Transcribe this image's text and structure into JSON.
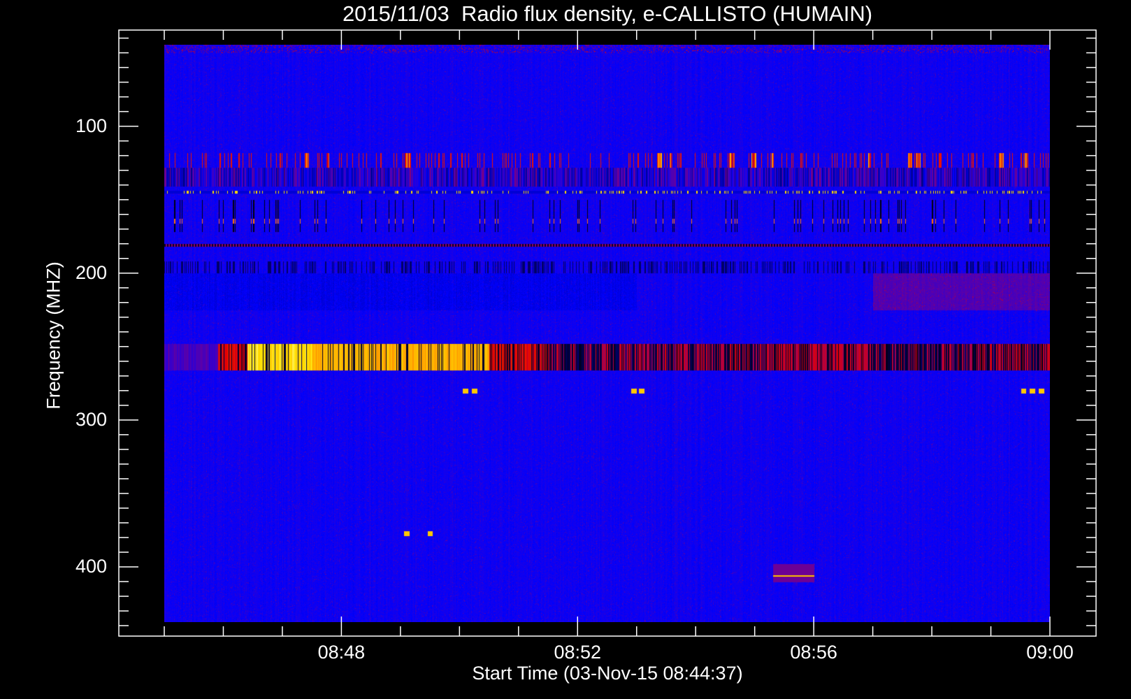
{
  "chart_data": {
    "type": "heatmap",
    "title": "2015/11/03  Radio flux density, e-CALLISTO (HUMAIN)",
    "xlabel": "Start Time (03-Nov-15 08:44:37)",
    "ylabel": "Frequency (MHZ)",
    "x_unit": "minutes after 08:45 UT",
    "xlim": [
      -0.76,
      15.78
    ],
    "data_xlim": [
      0,
      15
    ],
    "ylim": [
      447,
      34.6
    ],
    "data_ylim": [
      44.5,
      437.6
    ],
    "y_inverted": true,
    "x_major_ticks": [
      {
        "value": 3,
        "label": "08:48"
      },
      {
        "value": 7,
        "label": "08:52"
      },
      {
        "value": 11,
        "label": "08:56"
      },
      {
        "value": 15,
        "label": "09:00"
      }
    ],
    "x_minor_step": 1,
    "y_major_ticks": [
      {
        "value": 100,
        "label": "100"
      },
      {
        "value": 200,
        "label": "200"
      },
      {
        "value": 300,
        "label": "300"
      },
      {
        "value": 400,
        "label": "400"
      }
    ],
    "y_minor_step": 10,
    "colormap": [
      "#000000",
      "#0000ff",
      "#6400a0",
      "#e60000",
      "#ff8c00",
      "#ffe600",
      "#ffffff"
    ],
    "features": {
      "background_level": 0.3,
      "hot_band_mhz": [
        248,
        266
      ],
      "hot_band_segments": [
        {
          "t": [
            0.9,
            1.4
          ],
          "level": 0.62
        },
        {
          "t": [
            1.4,
            2.5
          ],
          "level": 0.9
        },
        {
          "t": [
            2.5,
            5.5
          ],
          "level": 0.82
        },
        {
          "t": [
            5.5,
            6.5
          ],
          "level": 0.62
        },
        {
          "t": [
            10.2,
            11.9
          ],
          "level": 0.58
        }
      ],
      "red_patch_band_mhz": [
        118,
        128
      ],
      "dotted_line_mhz": 144.5,
      "black_bar_band_mhz": [
        150,
        172
      ],
      "black_line_mhz": 181,
      "dark_stripe_band_mhz": [
        192,
        200
      ],
      "point_bursts": [
        {
          "t": 5.1,
          "mhz": 280
        },
        {
          "t": 5.25,
          "mhz": 280
        },
        {
          "t": 7.95,
          "mhz": 280
        },
        {
          "t": 8.08,
          "mhz": 280
        },
        {
          "t": 14.55,
          "mhz": 280
        },
        {
          "t": 14.7,
          "mhz": 280
        },
        {
          "t": 14.85,
          "mhz": 280
        },
        {
          "t": 4.1,
          "mhz": 377
        },
        {
          "t": 4.5,
          "mhz": 377
        }
      ],
      "box_patch": {
        "t": [
          10.3,
          11.0
        ],
        "mhz": [
          398,
          410
        ],
        "line_mhz": 406
      }
    }
  }
}
